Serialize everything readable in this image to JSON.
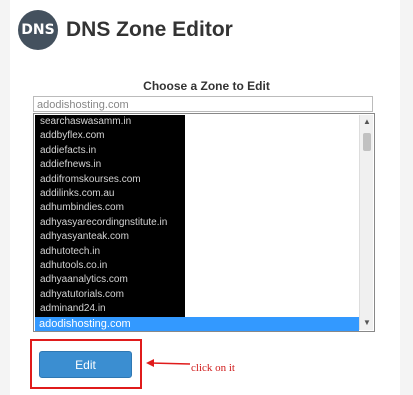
{
  "header": {
    "logo_text": "DNS",
    "title": "DNS Zone Editor"
  },
  "zone": {
    "label": "Choose a Zone to Edit",
    "input_value": "adodishosting.com",
    "options": [
      "searchaswasamm.in",
      "addbyflex.com",
      "addiefacts.in",
      "addiefnews.in",
      "addifromskourses.com",
      "addilinks.com.au",
      "adhumbindies.com",
      "adhyasyarecordingnstitute.in",
      "adhyasyanteak.com",
      "adhutotech.in",
      "adhutools.co.in",
      "adhyaanalytics.com",
      "adhyatutorials.com",
      "adminand24.in"
    ],
    "selected_option": "adodishosting.com"
  },
  "actions": {
    "edit_label": "Edit"
  },
  "annotation": {
    "text": "click on it",
    "color": "#e01b1b"
  },
  "colors": {
    "button": "#3b8ed1",
    "selection": "#3399ff",
    "logo": "#44515e"
  }
}
